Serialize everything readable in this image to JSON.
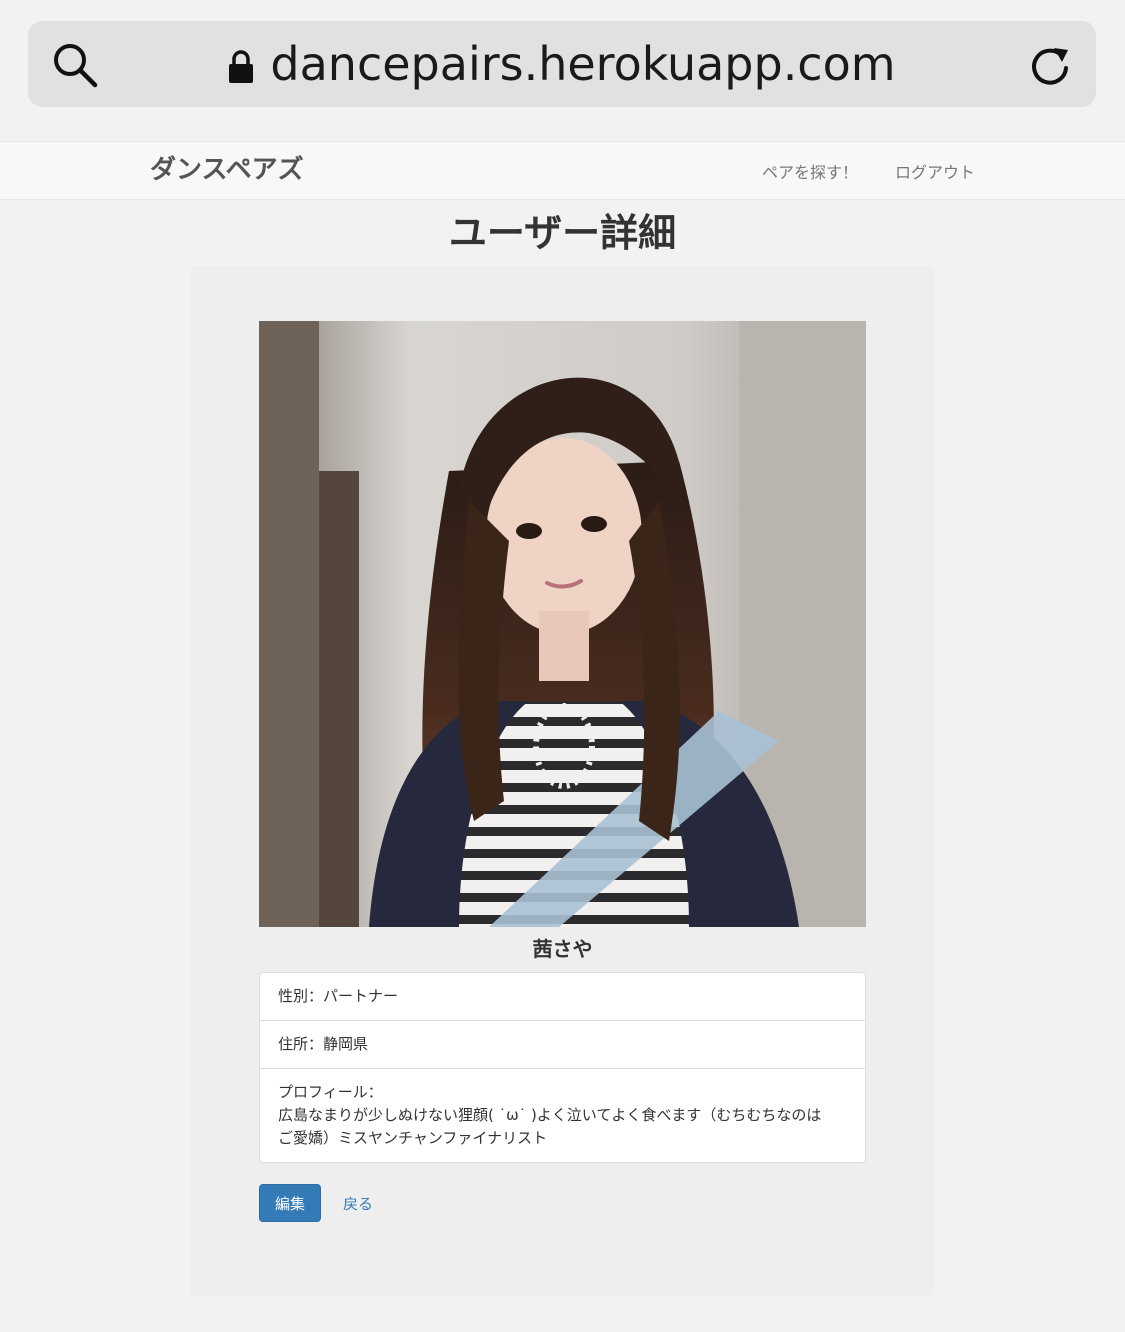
{
  "browser": {
    "url": "dancepairs.herokuapp.com",
    "icons": {
      "search": "search-icon",
      "lock": "lock-icon",
      "reload": "reload-icon"
    }
  },
  "navbar": {
    "brand": "ダンスペアズ",
    "links": [
      {
        "label": "ペアを探す！"
      },
      {
        "label": "ログアウト"
      }
    ]
  },
  "page": {
    "title": "ユーザー詳細"
  },
  "user": {
    "photo_alt": "photo",
    "name": "茜さや",
    "details": {
      "gender": "性別：パートナー",
      "address": "住所：静岡県",
      "profile_label": "プロフィール：",
      "profile_line1": "広島なまりが少しぬけない狸顔( ˙ω˙ )よく泣いてよく食べます（むちむちなのは",
      "profile_line2": "ご愛嬌）ミスヤンチャンファイナリスト"
    }
  },
  "actions": {
    "edit_label": "編集",
    "back_label": "戻る"
  },
  "colors": {
    "primary": "#337ab7",
    "background": "#f3f2f2",
    "card": "#eeeeee"
  }
}
